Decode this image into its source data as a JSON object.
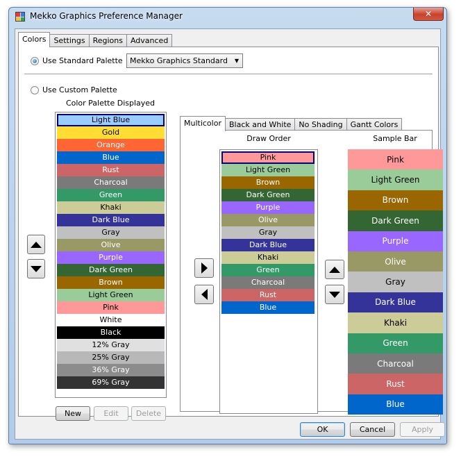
{
  "window": {
    "title": "Mekko Graphics Preference Manager",
    "close_glyph": "✕"
  },
  "tabs": [
    "Colors",
    "Settings",
    "Regions",
    "Advanced"
  ],
  "standard": {
    "label": "Use Standard Palette",
    "selected": true,
    "palette_value": "Mekko Graphics Standard",
    "dropdown_glyph": "▼"
  },
  "custom": {
    "label": "Use Custom Palette",
    "selected": false
  },
  "palette_displayed": {
    "title": "Color Palette Displayed",
    "selected_index": 0,
    "items": [
      {
        "label": "Light Blue",
        "color": "#99ccff",
        "text": "#000000"
      },
      {
        "label": "Gold",
        "color": "#ffdd33",
        "text": "#000000"
      },
      {
        "label": "Orange",
        "color": "#ff6633",
        "text": "#ffffff"
      },
      {
        "label": "Blue",
        "color": "#0066cc",
        "text": "#ffffff"
      },
      {
        "label": "Rust",
        "color": "#cc6666",
        "text": "#ffffff"
      },
      {
        "label": "Charcoal",
        "color": "#7a7a7a",
        "text": "#ffffff"
      },
      {
        "label": "Green",
        "color": "#339966",
        "text": "#ffffff"
      },
      {
        "label": "Khaki",
        "color": "#cccc99",
        "text": "#000000"
      },
      {
        "label": "Dark Blue",
        "color": "#333399",
        "text": "#ffffff"
      },
      {
        "label": "Gray",
        "color": "#c0c0c0",
        "text": "#000000"
      },
      {
        "label": "Olive",
        "color": "#999966",
        "text": "#ffffff"
      },
      {
        "label": "Purple",
        "color": "#9966ff",
        "text": "#ffffff"
      },
      {
        "label": "Dark Green",
        "color": "#336633",
        "text": "#ffffff"
      },
      {
        "label": "Brown",
        "color": "#996600",
        "text": "#ffffff"
      },
      {
        "label": "Light Green",
        "color": "#99cc99",
        "text": "#000000"
      },
      {
        "label": "Pink",
        "color": "#ff9999",
        "text": "#000000"
      },
      {
        "label": "White",
        "color": "#ffffff",
        "text": "#000000"
      },
      {
        "label": "Black",
        "color": "#000000",
        "text": "#ffffff"
      },
      {
        "label": "12% Gray",
        "color": "#e0e0e0",
        "text": "#000000"
      },
      {
        "label": "25% Gray",
        "color": "#b8b8b8",
        "text": "#000000"
      },
      {
        "label": "36% Gray",
        "color": "#8c8c8c",
        "text": "#ffffff"
      },
      {
        "label": "69% Gray",
        "color": "#333333",
        "text": "#ffffff"
      }
    ]
  },
  "buttons": {
    "new": "New",
    "edit": "Edit",
    "delete": "Delete",
    "ok": "OK",
    "cancel": "Cancel",
    "apply": "Apply"
  },
  "sub_tabs": [
    "Multicolor",
    "Black and White",
    "No Shading",
    "Gantt Colors"
  ],
  "draw_order": {
    "title": "Draw Order",
    "selected_index": 0,
    "items": [
      {
        "label": "Pink",
        "color": "#ff9999",
        "text": "#000000"
      },
      {
        "label": "Light Green",
        "color": "#99cc99",
        "text": "#000000"
      },
      {
        "label": "Brown",
        "color": "#996600",
        "text": "#ffffff"
      },
      {
        "label": "Dark Green",
        "color": "#336633",
        "text": "#ffffff"
      },
      {
        "label": "Purple",
        "color": "#9966ff",
        "text": "#ffffff"
      },
      {
        "label": "Olive",
        "color": "#999966",
        "text": "#ffffff"
      },
      {
        "label": "Gray",
        "color": "#c0c0c0",
        "text": "#000000"
      },
      {
        "label": "Dark Blue",
        "color": "#333399",
        "text": "#ffffff"
      },
      {
        "label": "Khaki",
        "color": "#cccc99",
        "text": "#000000"
      },
      {
        "label": "Green",
        "color": "#339966",
        "text": "#ffffff"
      },
      {
        "label": "Charcoal",
        "color": "#7a7a7a",
        "text": "#ffffff"
      },
      {
        "label": "Rust",
        "color": "#cc6666",
        "text": "#ffffff"
      },
      {
        "label": "Blue",
        "color": "#0066cc",
        "text": "#ffffff"
      }
    ]
  },
  "sample_bar": {
    "title": "Sample Bar",
    "items": [
      {
        "label": "Pink",
        "color": "#ff9999",
        "text": "#000000"
      },
      {
        "label": "Light Green",
        "color": "#99cc99",
        "text": "#000000"
      },
      {
        "label": "Brown",
        "color": "#996600",
        "text": "#ffffff"
      },
      {
        "label": "Dark Green",
        "color": "#336633",
        "text": "#ffffff"
      },
      {
        "label": "Purple",
        "color": "#9966ff",
        "text": "#ffffff"
      },
      {
        "label": "Olive",
        "color": "#999966",
        "text": "#ffffff"
      },
      {
        "label": "Gray",
        "color": "#c0c0c0",
        "text": "#000000"
      },
      {
        "label": "Dark Blue",
        "color": "#333399",
        "text": "#ffffff"
      },
      {
        "label": "Khaki",
        "color": "#cccc99",
        "text": "#000000"
      },
      {
        "label": "Green",
        "color": "#339966",
        "text": "#ffffff"
      },
      {
        "label": "Charcoal",
        "color": "#7a7a7a",
        "text": "#ffffff"
      },
      {
        "label": "Rust",
        "color": "#cc6666",
        "text": "#ffffff"
      },
      {
        "label": "Blue",
        "color": "#0066cc",
        "text": "#ffffff"
      }
    ]
  }
}
